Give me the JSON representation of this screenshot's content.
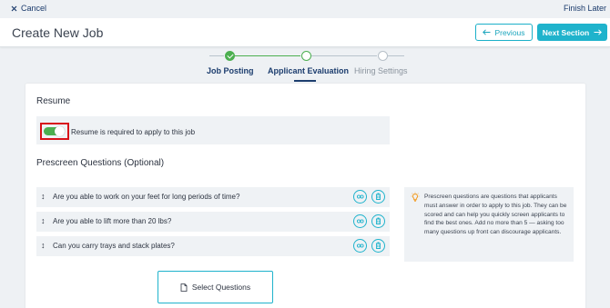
{
  "topbar": {
    "cancel_label": "Cancel",
    "finish_label": "Finish Later"
  },
  "header": {
    "title": "Create New Job",
    "previous_label": "Previous",
    "next_label": "Next Section"
  },
  "stepper": {
    "steps": [
      {
        "label": "Job Posting",
        "state": "done"
      },
      {
        "label": "Applicant Evaluation",
        "state": "active"
      },
      {
        "label": "Hiring Settings",
        "state": "todo"
      }
    ]
  },
  "resume": {
    "section_title": "Resume",
    "toggle_label": "Resume is required to apply to this job",
    "toggle_on": true
  },
  "prescreen": {
    "section_title": "Prescreen Questions (Optional)",
    "questions": [
      {
        "text": "Are you able to work on your feet for long periods of time?"
      },
      {
        "text": "Are you able to lift more than 20 lbs?"
      },
      {
        "text": "Can you carry trays and stack plates?"
      }
    ],
    "tip": "Prescreen questions are questions that applicants must answer in order to apply to this job. They can be scored and can help you quickly screen applicants to find the best ones. Add no more than 5 — asking too many questions up front can discourage applicants.",
    "select_label": "Select Questions"
  },
  "colors": {
    "accent": "#1fb3cc",
    "navy": "#1c3d6e",
    "success": "#4caf50",
    "highlight": "#d8121a"
  },
  "icons": {
    "cancel": "close-icon",
    "previous": "arrow-left-icon",
    "next": "arrow-right-icon",
    "drag": "drag-handle-icon",
    "edit": "edit-icon",
    "delete": "delete-icon",
    "tip": "lightbulb-icon",
    "select": "document-icon"
  }
}
